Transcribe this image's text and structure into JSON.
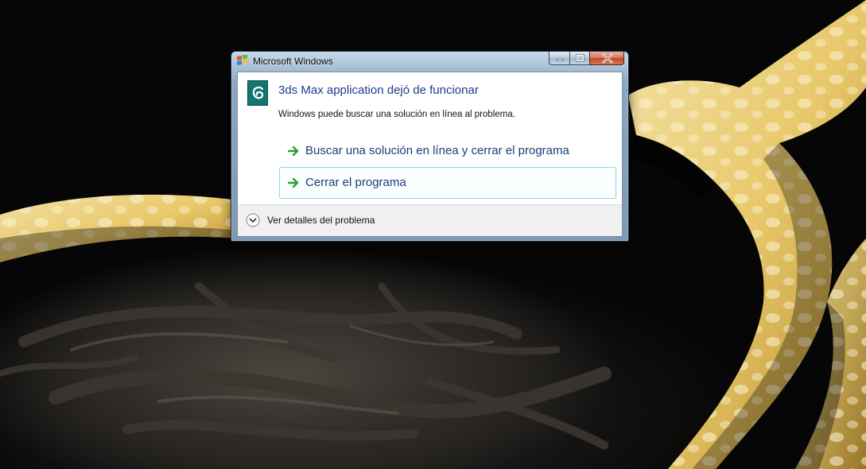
{
  "window": {
    "title": "Microsoft Windows",
    "title_icon": "windows-flag-icon"
  },
  "dialog": {
    "app_icon": "3ds-max-icon",
    "heading": "3ds Max application dejó de funcionar",
    "description": "Windows puede buscar una solución en línea al problema.",
    "options": [
      {
        "label": "Buscar una solución en línea y cerrar el programa",
        "icon": "green-arrow-icon"
      },
      {
        "label": "Cerrar el programa",
        "icon": "green-arrow-icon"
      }
    ],
    "details_label": "Ver detalles del problema",
    "details_icon": "chevron-down-icon"
  },
  "colors": {
    "heading": "#1f3d8f",
    "link": "#1c3c7a",
    "hover_border": "#8fd3ea",
    "arrow": "#2aa12a"
  }
}
